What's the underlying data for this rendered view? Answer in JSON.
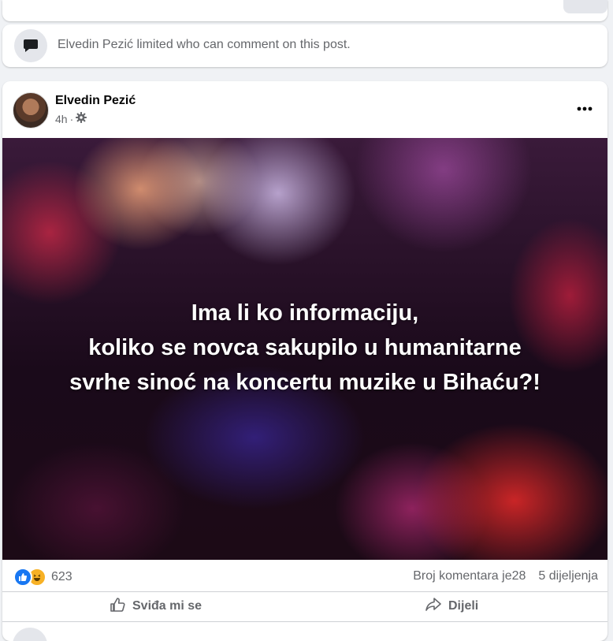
{
  "notice": {
    "text": "Elvedin Pezić limited who can comment on this post.",
    "icon": "comment-bubble-icon"
  },
  "post": {
    "author": "Elvedin Pezić",
    "time": "4h",
    "separator": "·",
    "privacy_icon": "gear-icon",
    "image_text_lines": [
      "Ima li ko informaciju,",
      "koliko se novca sakupilo u humanitarne",
      "svrhe sinoć na koncertu muzike u Bihaću?!"
    ],
    "reactions": {
      "icons": [
        "like-reaction-icon",
        "haha-reaction-icon"
      ],
      "count": "623"
    },
    "comments_text": "Broj komentara je28",
    "shares_text": "5 dijeljenja",
    "actions": {
      "like_label": "Sviđa mi se",
      "share_label": "Dijeli"
    }
  },
  "colors": {
    "accent": "#1877f2",
    "secondary_text": "#65676b",
    "haha": "#f7b125"
  }
}
